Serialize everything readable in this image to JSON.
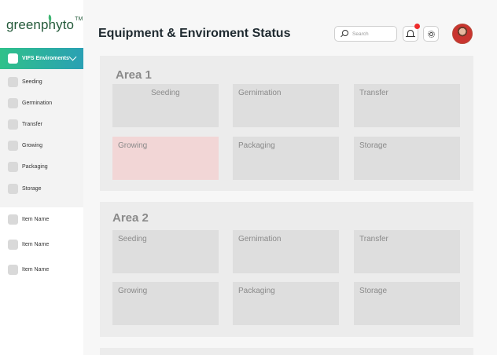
{
  "app": {
    "logo_text": "greenphyto",
    "logo_tm": "TM"
  },
  "sidebar": {
    "group_label": "VIFS Enviroments",
    "items": [
      {
        "label": "Seeding"
      },
      {
        "label": "Germination"
      },
      {
        "label": "Transfer"
      },
      {
        "label": "Growing"
      },
      {
        "label": "Packaging"
      },
      {
        "label": "Storage"
      }
    ],
    "extra_items": [
      {
        "label": "Item Name"
      },
      {
        "label": "Item Name"
      },
      {
        "label": "Item Name"
      }
    ]
  },
  "header": {
    "title": "Equipment & Enviroment Status",
    "search_placeholder": "Search",
    "notification_badge_color": "#ee2b2b"
  },
  "areas": [
    {
      "title": "Area 1",
      "tiles": [
        {
          "label": "Seeding"
        },
        {
          "label": "Gernimation"
        },
        {
          "label": "Transfer"
        },
        {
          "label": "Growing",
          "status": "alert"
        },
        {
          "label": "Packaging"
        },
        {
          "label": "Storage"
        }
      ]
    },
    {
      "title": "Area 2",
      "tiles": [
        {
          "label": "Seeding"
        },
        {
          "label": "Gernimation"
        },
        {
          "label": "Transfer"
        },
        {
          "label": "Growing"
        },
        {
          "label": "Packaging"
        },
        {
          "label": "Storage"
        }
      ]
    }
  ],
  "colors": {
    "brand_gradient_start": "#2fc18a",
    "brand_gradient_end": "#2aa0b4",
    "alert_tile": "#f2d6d6"
  }
}
